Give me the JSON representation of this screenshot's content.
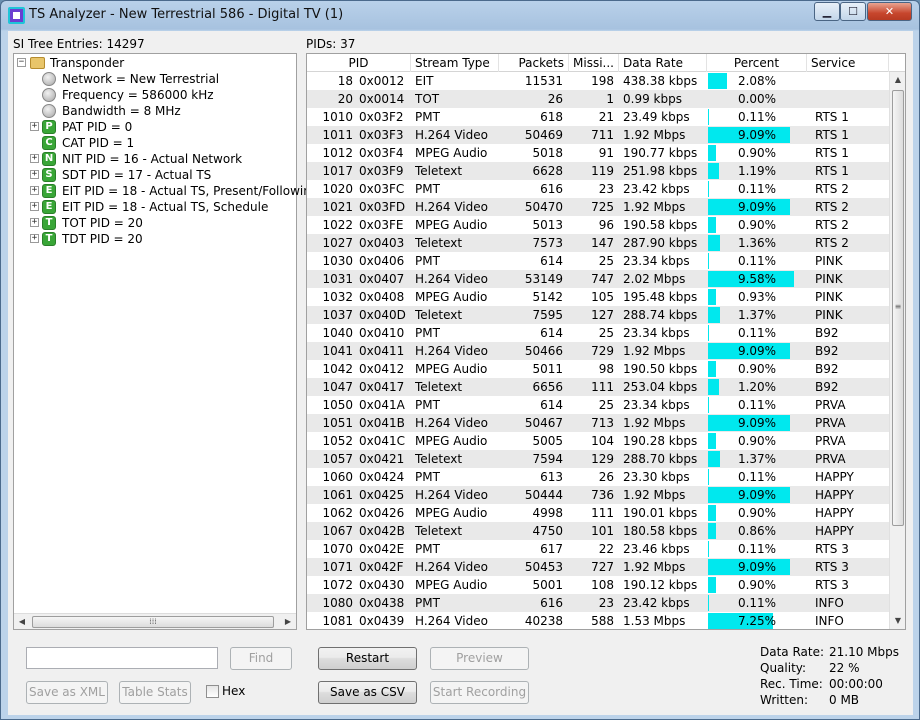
{
  "window": {
    "title": "TS Analyzer - New Terrestrial 586 - Digital TV (1)"
  },
  "tree": {
    "caption": "SI Tree Entries: 14297",
    "nodes": [
      {
        "label": "Transponder",
        "icon": "folder-icon",
        "expander": "−"
      },
      {
        "label": "Network = New Terrestrial",
        "icon": "gray-ball-icon",
        "expander": ""
      },
      {
        "label": "Frequency = 586000 kHz",
        "icon": "gray-ball-icon",
        "expander": ""
      },
      {
        "label": "Bandwidth = 8 MHz",
        "icon": "gray-ball-icon",
        "expander": ""
      },
      {
        "label": "PAT PID = 0",
        "icon": "P",
        "expander": "+"
      },
      {
        "label": "CAT PID = 1",
        "icon": "C",
        "expander": ""
      },
      {
        "label": "NIT PID = 16 - Actual Network",
        "icon": "N",
        "expander": "+"
      },
      {
        "label": "SDT PID = 17 - Actual TS",
        "icon": "S",
        "expander": "+"
      },
      {
        "label": "EIT PID = 18 - Actual TS, Present/Following",
        "icon": "E",
        "expander": "+"
      },
      {
        "label": "EIT PID = 18 - Actual TS, Schedule",
        "icon": "E",
        "expander": "+"
      },
      {
        "label": "TOT PID = 20",
        "icon": "T",
        "expander": "+"
      },
      {
        "label": "TDT PID = 20",
        "icon": "T",
        "expander": "+"
      }
    ],
    "find_label": "Find",
    "find_value": "",
    "save_xml_label": "Save as XML",
    "table_stats_label": "Table Stats",
    "hex_label": "Hex"
  },
  "pids": {
    "caption": "PIDs: 37",
    "columns": [
      "PID",
      "Stream Type",
      "Packets",
      "Missi...",
      "Data Rate",
      "Percent",
      "Service"
    ],
    "rows": [
      {
        "pid": "18",
        "hex": "0x0012",
        "type": "EIT",
        "packets": "11531",
        "missing": "198",
        "rate": "438.38 kbps",
        "percent": "2.08%",
        "pct": 2.08,
        "service": ""
      },
      {
        "pid": "20",
        "hex": "0x0014",
        "type": "TOT",
        "packets": "26",
        "missing": "1",
        "rate": "0.99 kbps",
        "percent": "0.00%",
        "pct": 0.0,
        "service": ""
      },
      {
        "pid": "1010",
        "hex": "0x03F2",
        "type": "PMT",
        "packets": "618",
        "missing": "21",
        "rate": "23.49 kbps",
        "percent": "0.11%",
        "pct": 0.11,
        "service": "RTS 1"
      },
      {
        "pid": "1011",
        "hex": "0x03F3",
        "type": "H.264 Video",
        "packets": "50469",
        "missing": "711",
        "rate": "1.92 Mbps",
        "percent": "9.09%",
        "pct": 9.09,
        "service": "RTS 1"
      },
      {
        "pid": "1012",
        "hex": "0x03F4",
        "type": "MPEG Audio",
        "packets": "5018",
        "missing": "91",
        "rate": "190.77 kbps",
        "percent": "0.90%",
        "pct": 0.9,
        "service": "RTS 1"
      },
      {
        "pid": "1017",
        "hex": "0x03F9",
        "type": "Teletext",
        "packets": "6628",
        "missing": "119",
        "rate": "251.98 kbps",
        "percent": "1.19%",
        "pct": 1.19,
        "service": "RTS 1"
      },
      {
        "pid": "1020",
        "hex": "0x03FC",
        "type": "PMT",
        "packets": "616",
        "missing": "23",
        "rate": "23.42 kbps",
        "percent": "0.11%",
        "pct": 0.11,
        "service": "RTS 2"
      },
      {
        "pid": "1021",
        "hex": "0x03FD",
        "type": "H.264 Video",
        "packets": "50470",
        "missing": "725",
        "rate": "1.92 Mbps",
        "percent": "9.09%",
        "pct": 9.09,
        "service": "RTS 2"
      },
      {
        "pid": "1022",
        "hex": "0x03FE",
        "type": "MPEG Audio",
        "packets": "5013",
        "missing": "96",
        "rate": "190.58 kbps",
        "percent": "0.90%",
        "pct": 0.9,
        "service": "RTS 2"
      },
      {
        "pid": "1027",
        "hex": "0x0403",
        "type": "Teletext",
        "packets": "7573",
        "missing": "147",
        "rate": "287.90 kbps",
        "percent": "1.36%",
        "pct": 1.36,
        "service": "RTS 2"
      },
      {
        "pid": "1030",
        "hex": "0x0406",
        "type": "PMT",
        "packets": "614",
        "missing": "25",
        "rate": "23.34 kbps",
        "percent": "0.11%",
        "pct": 0.11,
        "service": "PINK"
      },
      {
        "pid": "1031",
        "hex": "0x0407",
        "type": "H.264 Video",
        "packets": "53149",
        "missing": "747",
        "rate": "2.02 Mbps",
        "percent": "9.58%",
        "pct": 9.58,
        "service": "PINK"
      },
      {
        "pid": "1032",
        "hex": "0x0408",
        "type": "MPEG Audio",
        "packets": "5142",
        "missing": "105",
        "rate": "195.48 kbps",
        "percent": "0.93%",
        "pct": 0.93,
        "service": "PINK"
      },
      {
        "pid": "1037",
        "hex": "0x040D",
        "type": "Teletext",
        "packets": "7595",
        "missing": "127",
        "rate": "288.74 kbps",
        "percent": "1.37%",
        "pct": 1.37,
        "service": "PINK"
      },
      {
        "pid": "1040",
        "hex": "0x0410",
        "type": "PMT",
        "packets": "614",
        "missing": "25",
        "rate": "23.34 kbps",
        "percent": "0.11%",
        "pct": 0.11,
        "service": "B92"
      },
      {
        "pid": "1041",
        "hex": "0x0411",
        "type": "H.264 Video",
        "packets": "50466",
        "missing": "729",
        "rate": "1.92 Mbps",
        "percent": "9.09%",
        "pct": 9.09,
        "service": "B92"
      },
      {
        "pid": "1042",
        "hex": "0x0412",
        "type": "MPEG Audio",
        "packets": "5011",
        "missing": "98",
        "rate": "190.50 kbps",
        "percent": "0.90%",
        "pct": 0.9,
        "service": "B92"
      },
      {
        "pid": "1047",
        "hex": "0x0417",
        "type": "Teletext",
        "packets": "6656",
        "missing": "111",
        "rate": "253.04 kbps",
        "percent": "1.20%",
        "pct": 1.2,
        "service": "B92"
      },
      {
        "pid": "1050",
        "hex": "0x041A",
        "type": "PMT",
        "packets": "614",
        "missing": "25",
        "rate": "23.34 kbps",
        "percent": "0.11%",
        "pct": 0.11,
        "service": "PRVA"
      },
      {
        "pid": "1051",
        "hex": "0x041B",
        "type": "H.264 Video",
        "packets": "50467",
        "missing": "713",
        "rate": "1.92 Mbps",
        "percent": "9.09%",
        "pct": 9.09,
        "service": "PRVA"
      },
      {
        "pid": "1052",
        "hex": "0x041C",
        "type": "MPEG Audio",
        "packets": "5005",
        "missing": "104",
        "rate": "190.28 kbps",
        "percent": "0.90%",
        "pct": 0.9,
        "service": "PRVA"
      },
      {
        "pid": "1057",
        "hex": "0x0421",
        "type": "Teletext",
        "packets": "7594",
        "missing": "129",
        "rate": "288.70 kbps",
        "percent": "1.37%",
        "pct": 1.37,
        "service": "PRVA"
      },
      {
        "pid": "1060",
        "hex": "0x0424",
        "type": "PMT",
        "packets": "613",
        "missing": "26",
        "rate": "23.30 kbps",
        "percent": "0.11%",
        "pct": 0.11,
        "service": "HAPPY"
      },
      {
        "pid": "1061",
        "hex": "0x0425",
        "type": "H.264 Video",
        "packets": "50444",
        "missing": "736",
        "rate": "1.92 Mbps",
        "percent": "9.09%",
        "pct": 9.09,
        "service": "HAPPY"
      },
      {
        "pid": "1062",
        "hex": "0x0426",
        "type": "MPEG Audio",
        "packets": "4998",
        "missing": "111",
        "rate": "190.01 kbps",
        "percent": "0.90%",
        "pct": 0.9,
        "service": "HAPPY"
      },
      {
        "pid": "1067",
        "hex": "0x042B",
        "type": "Teletext",
        "packets": "4750",
        "missing": "101",
        "rate": "180.58 kbps",
        "percent": "0.86%",
        "pct": 0.86,
        "service": "HAPPY"
      },
      {
        "pid": "1070",
        "hex": "0x042E",
        "type": "PMT",
        "packets": "617",
        "missing": "22",
        "rate": "23.46 kbps",
        "percent": "0.11%",
        "pct": 0.11,
        "service": "RTS 3"
      },
      {
        "pid": "1071",
        "hex": "0x042F",
        "type": "H.264 Video",
        "packets": "50453",
        "missing": "727",
        "rate": "1.92 Mbps",
        "percent": "9.09%",
        "pct": 9.09,
        "service": "RTS 3"
      },
      {
        "pid": "1072",
        "hex": "0x0430",
        "type": "MPEG Audio",
        "packets": "5001",
        "missing": "108",
        "rate": "190.12 kbps",
        "percent": "0.90%",
        "pct": 0.9,
        "service": "RTS 3"
      },
      {
        "pid": "1080",
        "hex": "0x0438",
        "type": "PMT",
        "packets": "616",
        "missing": "23",
        "rate": "23.42 kbps",
        "percent": "0.11%",
        "pct": 0.11,
        "service": "INFO"
      },
      {
        "pid": "1081",
        "hex": "0x0439",
        "type": "H.264 Video",
        "packets": "40238",
        "missing": "588",
        "rate": "1.53 Mbps",
        "percent": "7.25%",
        "pct": 7.25,
        "service": "INFO"
      }
    ],
    "restart_label": "Restart",
    "preview_label": "Preview",
    "save_csv_label": "Save as CSV",
    "start_recording_label": "Start Recording"
  },
  "stats": {
    "data_rate_label": "Data Rate:",
    "data_rate_value": "21.10 Mbps",
    "quality_label": "Quality:",
    "quality_value": "22 %",
    "rec_time_label": "Rec. Time:",
    "rec_time_value": "00:00:00",
    "written_label": "Written:",
    "written_value": "0 MB"
  },
  "colors": {
    "percent_bar": "#00e8ee",
    "node_badge": "#39a637",
    "alt_row": "#e9e9e9"
  }
}
